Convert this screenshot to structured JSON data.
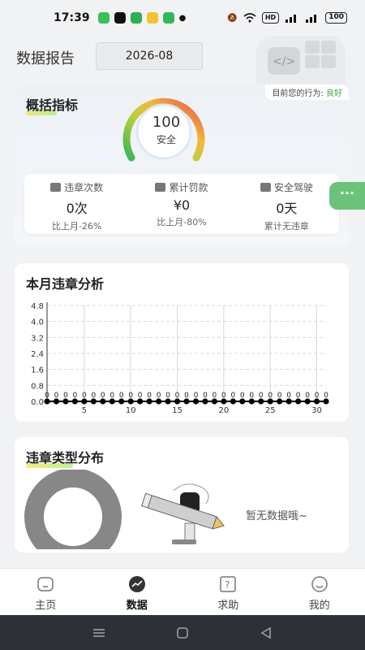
{
  "status_bar": {
    "time": "17:39",
    "battery": "100",
    "hd": "HD"
  },
  "header": {
    "title": "数据报告",
    "month": "2026-08"
  },
  "overview": {
    "title": "概括指标",
    "behavior_prefix": "目前您的行为: ",
    "behavior_value": "良好",
    "score": "100",
    "score_label": "安全",
    "metrics": [
      {
        "icon": "car-icon",
        "label": "违章次数",
        "value": "0次",
        "sub": "比上月-26%"
      },
      {
        "icon": "fine-icon",
        "label": "累计罚款",
        "value": "¥0",
        "sub": "比上月-80%"
      },
      {
        "icon": "safe-drive-icon",
        "label": "安全驾驶",
        "value": "0天",
        "sub": "累计无违章"
      }
    ]
  },
  "float_button": "···",
  "monthly": {
    "title": "本月违章分析"
  },
  "chart_data": {
    "type": "line",
    "title": "",
    "xlabel": "",
    "ylabel": "",
    "x": [
      1,
      2,
      3,
      4,
      5,
      6,
      7,
      8,
      9,
      10,
      11,
      12,
      13,
      14,
      15,
      16,
      17,
      18,
      19,
      20,
      21,
      22,
      23,
      24,
      25,
      26,
      27,
      28,
      29,
      30,
      31
    ],
    "series": [
      {
        "values": [
          0,
          0,
          0,
          0,
          0,
          0,
          0,
          0,
          0,
          0,
          0,
          0,
          0,
          0,
          0,
          0,
          0,
          0,
          0,
          0,
          0,
          0,
          0,
          0,
          0,
          0,
          0,
          0,
          0,
          0,
          0
        ]
      }
    ],
    "x_ticks": [
      "5",
      "10",
      "15",
      "20",
      "25",
      "30"
    ],
    "y_ticks": [
      "0.0",
      "0.8",
      "1.6",
      "2.4",
      "3.2",
      "4.0",
      "4.8"
    ],
    "point_labels": "0",
    "ylim": [
      0,
      4.8
    ],
    "xlim": [
      1,
      31
    ],
    "grid": true,
    "colors": {
      "line": "#000000",
      "grid": "#d8d8d8"
    }
  },
  "distribution": {
    "title": "违章类型分布",
    "empty_text": "暂无数据哦~",
    "donut_color": "#878787"
  },
  "tabs": [
    {
      "icon": "home-icon",
      "label": "主页",
      "active": false
    },
    {
      "icon": "data-icon",
      "label": "数据",
      "active": true
    },
    {
      "icon": "help-icon",
      "label": "求助",
      "active": false
    },
    {
      "icon": "profile-icon",
      "label": "我的",
      "active": false
    }
  ],
  "colors": {
    "accent_green": "#3aa34a",
    "float_button": "#6cc27a",
    "nav_bg": "#2d3136"
  }
}
